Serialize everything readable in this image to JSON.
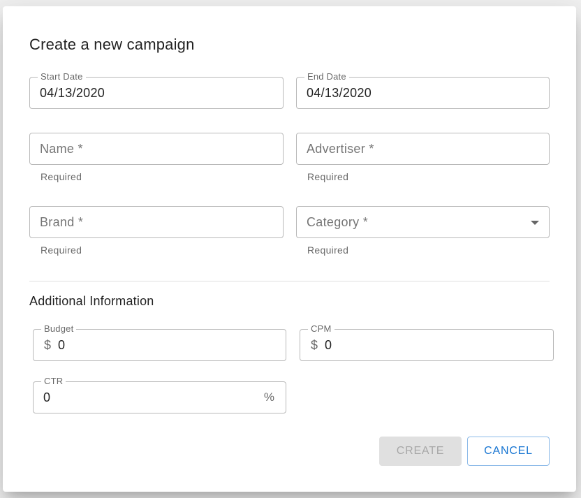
{
  "dialog": {
    "title": "Create a new campaign"
  },
  "fields": {
    "start_date": {
      "label": "Start Date",
      "value": "04/13/2020"
    },
    "end_date": {
      "label": "End Date",
      "value": "04/13/2020"
    },
    "name": {
      "placeholder": "Name *",
      "helper": "Required"
    },
    "advertiser": {
      "placeholder": "Advertiser *",
      "helper": "Required"
    },
    "brand": {
      "placeholder": "Brand *",
      "helper": "Required"
    },
    "category": {
      "placeholder": "Category *",
      "helper": "Required"
    }
  },
  "additional": {
    "title": "Additional Information",
    "budget": {
      "label": "Budget",
      "prefix": "$",
      "value": "0"
    },
    "cpm": {
      "label": "CPM",
      "prefix": "$",
      "value": "0"
    },
    "ctr": {
      "label": "CTR",
      "value": "0",
      "suffix": "%"
    }
  },
  "actions": {
    "create_label": "CREATE",
    "cancel_label": "CANCEL"
  },
  "colors": {
    "primary": "#1976d2",
    "disabled_bg": "#e0e0e0"
  }
}
